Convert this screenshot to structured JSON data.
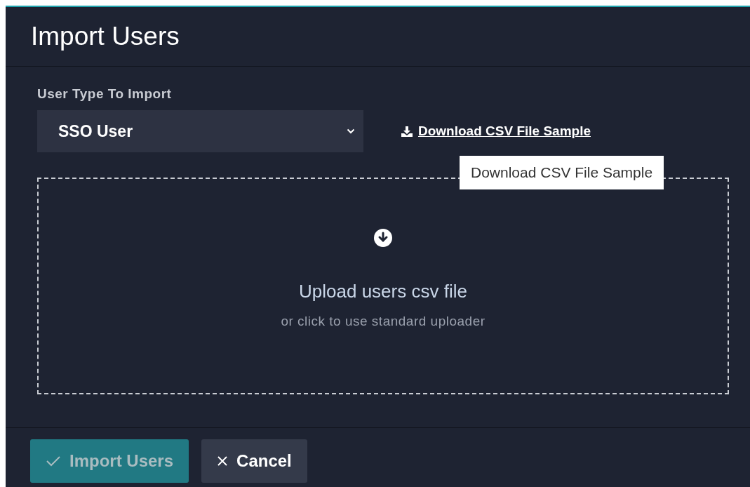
{
  "dialog": {
    "title": "Import Users"
  },
  "user_type": {
    "label": "User Type To Import",
    "value": "SSO User"
  },
  "download_link": {
    "label": "Download CSV File Sample"
  },
  "tooltip": {
    "text": "Download CSV File Sample"
  },
  "dropzone": {
    "title": "Upload users csv file",
    "hint": "or click to use standard uploader"
  },
  "buttons": [
    {
      "label": "Import Users",
      "kind": "primary",
      "disabled": true
    },
    {
      "label": "Cancel",
      "kind": "cancel",
      "disabled": false
    }
  ]
}
